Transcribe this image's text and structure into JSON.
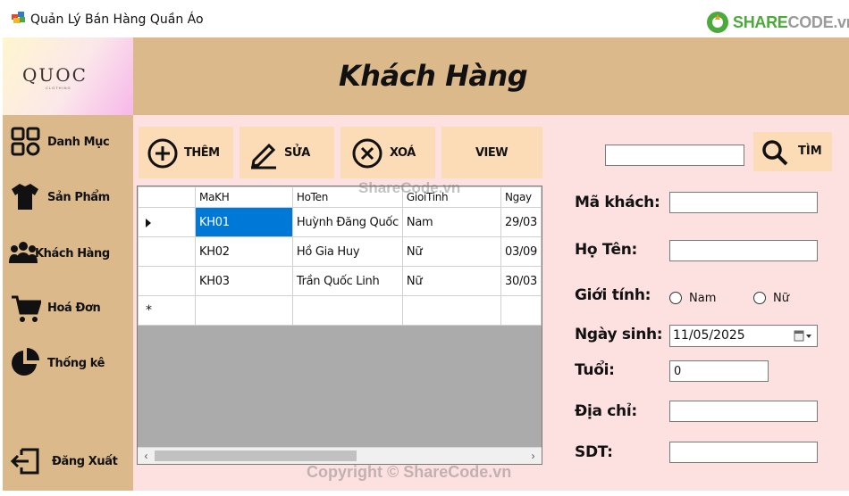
{
  "window": {
    "title": "Quản Lý Bán Hàng Quần Áo",
    "watermark_logo_prefix": "SHARE",
    "watermark_logo_suffix": "CODE.vn"
  },
  "brand": {
    "name": "QUOC",
    "sub": "CLOTHING"
  },
  "sidebar": {
    "items": [
      {
        "label": "Danh Mục",
        "icon": "grid-icon"
      },
      {
        "label": "Sản Phẩm",
        "icon": "shirt-icon"
      },
      {
        "label": "Khách Hàng",
        "icon": "users-icon"
      },
      {
        "label": "Hoá Đơn",
        "icon": "cart-icon"
      },
      {
        "label": "Thống kê",
        "icon": "pie-chart-icon"
      }
    ],
    "logout_label": "Đăng Xuất"
  },
  "header": {
    "title": "Khách Hàng"
  },
  "toolbar": {
    "add_label": "THÊM",
    "edit_label": "SỬA",
    "delete_label": "XOÁ",
    "view_label": "VIEW",
    "search_label": "TÌM",
    "search_value": ""
  },
  "table": {
    "columns": [
      "MaKH",
      "HoTen",
      "GioiTinh",
      "Ngay"
    ],
    "rows": [
      [
        "KH01",
        "Huỳnh Đăng Quốc",
        "Nam",
        "29/03"
      ],
      [
        "KH02",
        "Hồ Gia Huy",
        "Nữ",
        "03/09"
      ],
      [
        "KH03",
        "Trần Quốc Linh",
        "Nữ",
        "30/03"
      ]
    ],
    "new_row_marker": "*"
  },
  "form": {
    "ma_khach_label": "Mã khách:",
    "ma_khach_value": "",
    "ho_ten_label": "Họ Tên:",
    "ho_ten_value": "",
    "gioi_tinh_label": "Giới tính:",
    "gender_options": [
      "Nam",
      "Nữ"
    ],
    "ngay_sinh_label": "Ngày sinh:",
    "ngay_sinh_value": "11/05/2025",
    "tuoi_label": "Tuổi:",
    "tuoi_value": "0",
    "dia_chi_label": "Địa chỉ:",
    "dia_chi_value": "",
    "sdt_label": "SDT:",
    "sdt_value": ""
  },
  "watermarks": {
    "grid": "ShareCode.vn",
    "bottom": "Copyright © ShareCode.vn"
  },
  "colors": {
    "sidebar": "#dcb98b",
    "main_bg": "#fde1e0",
    "button_bg": "#fbdcb6",
    "selection": "#0078d7"
  }
}
